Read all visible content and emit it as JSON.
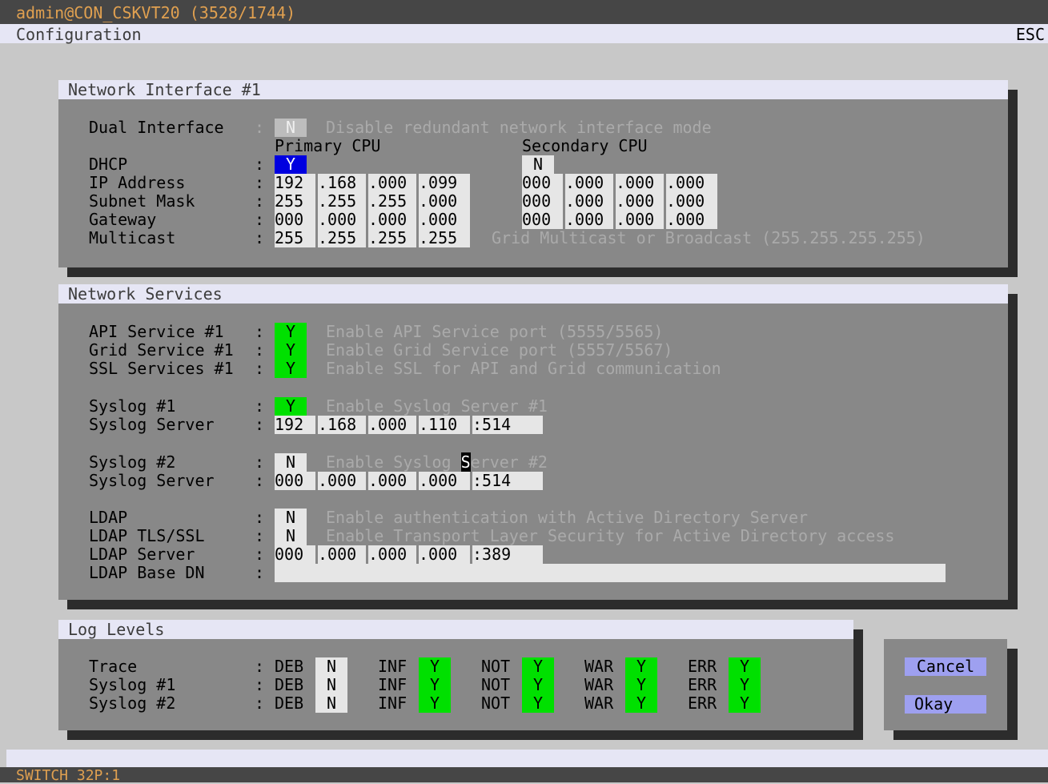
{
  "window": {
    "title": "admin@CON_CSKVT20 (3528/1744)",
    "header": "Configuration",
    "esc": "ESC",
    "status": "SWITCH 32P:1"
  },
  "ni": {
    "title": "Network Interface #1",
    "dual": {
      "label": "Dual Interface",
      "value": "N",
      "desc": "Disable redundant network interface mode"
    },
    "primary": "Primary CPU",
    "secondary": "Secondary CPU",
    "dhcp": {
      "label": "DHCP",
      "primary": "Y",
      "secondary": "N"
    },
    "ip": {
      "label": "IP Address",
      "primary": [
        "192",
        ".168",
        ".000",
        ".099"
      ],
      "secondary": [
        "000",
        ".000",
        ".000",
        ".000"
      ]
    },
    "mask": {
      "label": "Subnet Mask",
      "primary": [
        "255",
        ".255",
        ".255",
        ".000"
      ],
      "secondary": [
        "000",
        ".000",
        ".000",
        ".000"
      ]
    },
    "gw": {
      "label": "Gateway",
      "primary": [
        "000",
        ".000",
        ".000",
        ".000"
      ],
      "secondary": [
        "000",
        ".000",
        ".000",
        ".000"
      ]
    },
    "mc": {
      "label": "Multicast",
      "primary": [
        "255",
        ".255",
        ".255",
        ".255"
      ],
      "desc": "Grid Multicast or Broadcast (255.255.255.255)"
    }
  },
  "ns": {
    "title": "Network Services",
    "api": {
      "label": "API Service #1",
      "value": "Y",
      "desc": "Enable API Service port (5555/5565)"
    },
    "grid": {
      "label": "Grid Service #1",
      "value": "Y",
      "desc": "Enable Grid Service port (5557/5567)"
    },
    "ssl": {
      "label": "SSL Services #1",
      "value": "Y",
      "desc": "Enable SSL for API and Grid communication"
    },
    "syslog1": {
      "label": "Syslog #1",
      "value": "Y",
      "desc": "Enable Syslog Server #1"
    },
    "server1": {
      "label": "Syslog Server",
      "ip": [
        "192",
        ".168",
        ".000",
        ".110"
      ],
      "port": ":514"
    },
    "syslog2": {
      "label": "Syslog #2",
      "value": "N",
      "desc_a": "Enable Syslog ",
      "desc_cursor": "S",
      "desc_b": "erver #2"
    },
    "server2": {
      "label": "Syslog Server",
      "ip": [
        "000",
        ".000",
        ".000",
        ".000"
      ],
      "port": ":514"
    },
    "ldap": {
      "label": "LDAP",
      "value": "N",
      "desc": "Enable authentication with Active Directory Server"
    },
    "ldaptls": {
      "label": "LDAP TLS/SSL",
      "value": "N",
      "desc": "Enable Transport Layer Security for Active Directory access"
    },
    "ldapserver": {
      "label": "LDAP Server",
      "ip": [
        "000",
        ".000",
        ".000",
        ".000"
      ],
      "port": ":389"
    },
    "ldapbase": {
      "label": "LDAP Base DN",
      "value": ""
    }
  },
  "ll": {
    "title": "Log Levels",
    "levels": [
      "DEB",
      "INF",
      "NOT",
      "WAR",
      "ERR"
    ],
    "rows": [
      {
        "label": "Trace",
        "values": [
          "N",
          "Y",
          "Y",
          "Y",
          "Y"
        ]
      },
      {
        "label": "Syslog #1",
        "values": [
          "N",
          "Y",
          "Y",
          "Y",
          "Y"
        ]
      },
      {
        "label": "Syslog #2",
        "values": [
          "N",
          "Y",
          "Y",
          "Y",
          "Y"
        ]
      }
    ]
  },
  "buttons": {
    "cancel": "Cancel",
    "okay": "Okay"
  },
  "sep": ":"
}
